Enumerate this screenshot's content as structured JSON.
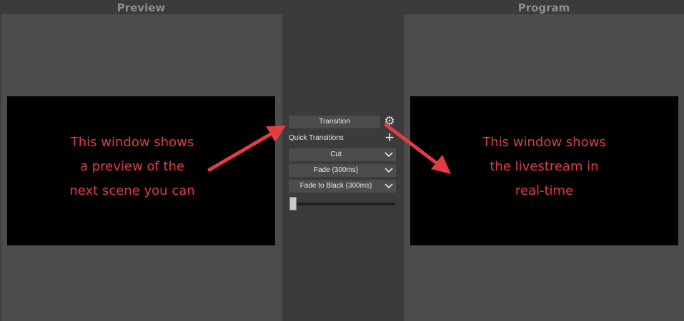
{
  "preview": {
    "title": "Preview",
    "note": "This window shows\na preview of the\nnext scene you can"
  },
  "program": {
    "title": "Program",
    "note": "This window shows\nthe livestream in\nreal-time"
  },
  "transitions": {
    "transition_button": "Transition",
    "quick_label": "Quick Transitions",
    "items": [
      "Cut",
      "Fade (300ms)",
      "Fade to Black (300ms)"
    ],
    "slider_value": 0
  },
  "colors": {
    "annotation": "#e23c45"
  },
  "icons": {
    "settings": "gear-icon",
    "add": "plus-icon",
    "dropdown": "chevron-down-icon"
  }
}
